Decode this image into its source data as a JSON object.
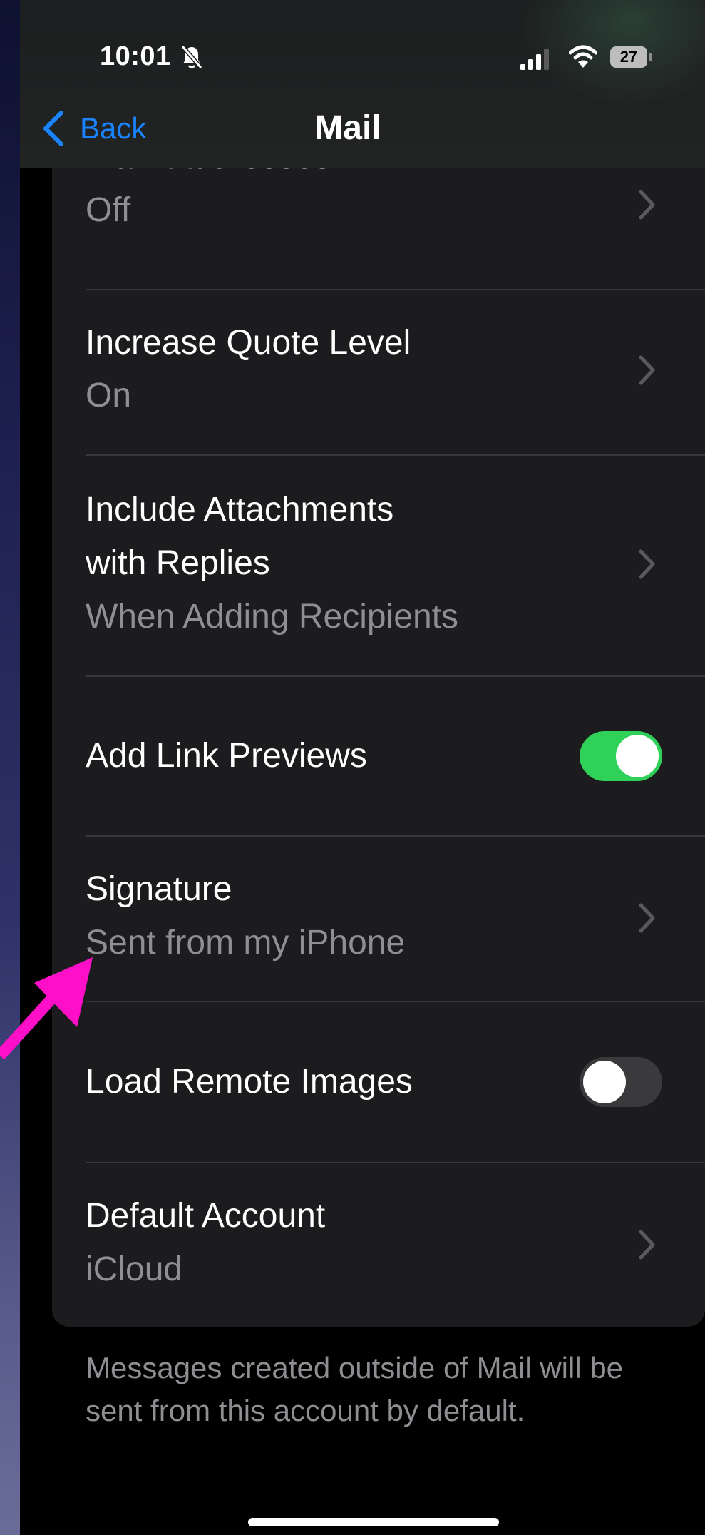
{
  "status_bar": {
    "time": "10:01",
    "battery_level": "27",
    "icons": [
      "bell-slash-icon",
      "cellular-signal-icon",
      "wifi-icon",
      "battery-icon"
    ]
  },
  "nav": {
    "back_label": "Back",
    "title": "Mail"
  },
  "rows": {
    "mark_addresses": {
      "title": "Mark Addresses",
      "value": "Off"
    },
    "increase_quote": {
      "title": "Increase Quote Level",
      "value": "On"
    },
    "include_attachments": {
      "title_line1": "Include Attachments",
      "title_line2": "with Replies",
      "value": "When Adding Recipients"
    },
    "link_previews": {
      "title": "Add Link Previews",
      "toggle_on": true
    },
    "signature": {
      "title": "Signature",
      "value": "Sent from my iPhone"
    },
    "remote_images": {
      "title": "Load Remote Images",
      "toggle_on": false
    },
    "default_account": {
      "title": "Default Account",
      "value": "iCloud"
    }
  },
  "footer": {
    "note": "Messages created outside of Mail will be sent from this account by default."
  },
  "colors": {
    "accent": "#1a84ff",
    "toggle_on": "#30d158",
    "annotation_arrow": "#ff10c8",
    "card_bg": "#1c1c1e",
    "secondary_text": "#8e8e93"
  }
}
